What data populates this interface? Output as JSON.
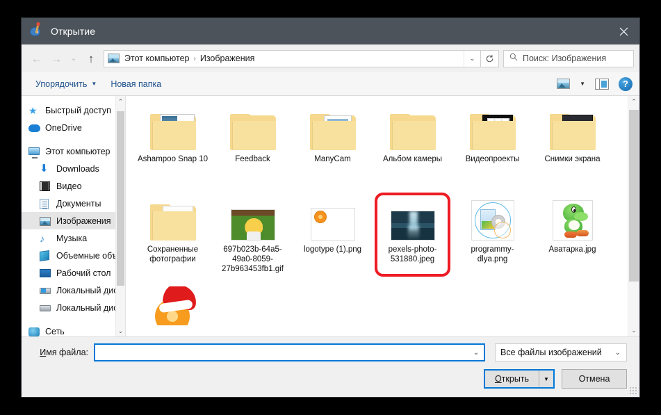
{
  "window": {
    "title": "Открытие",
    "title_icon": "paint-palette-icon",
    "close_label": "✕"
  },
  "nav": {
    "back_icon": "arrow-left-icon",
    "forward_icon": "arrow-right-icon",
    "recent_icon": "chevron-down-icon",
    "up_icon": "arrow-up-icon",
    "refresh_icon": "refresh-icon",
    "address_icon": "pictures-folder-icon",
    "breadcrumbs": [
      "Этот компьютер",
      "Изображения"
    ],
    "breadcrumb_separator": "›",
    "address_caret": "⌄"
  },
  "search": {
    "icon": "search-icon",
    "placeholder": "Поиск: Изображения"
  },
  "commandbar": {
    "organize_label": "Упорядочить",
    "organize_caret": "▼",
    "new_folder_label": "Новая папка",
    "view_icon": "view-layout-icon",
    "view_caret": "▼",
    "preview_pane_icon": "preview-pane-icon",
    "help_icon": "?"
  },
  "sidebar": {
    "items": [
      {
        "label": "Быстрый доступ",
        "icon": "star-icon",
        "indent": false,
        "selected": false
      },
      {
        "label": "OneDrive",
        "icon": "cloud-icon",
        "indent": false,
        "selected": false
      },
      {
        "label": "Этот компьютер",
        "icon": "computer-icon",
        "indent": false,
        "selected": false
      },
      {
        "label": "Downloads",
        "icon": "download-icon",
        "indent": true,
        "selected": false
      },
      {
        "label": "Видео",
        "icon": "video-icon",
        "indent": true,
        "selected": false
      },
      {
        "label": "Документы",
        "icon": "document-icon",
        "indent": true,
        "selected": false
      },
      {
        "label": "Изображения",
        "icon": "pictures-icon",
        "indent": true,
        "selected": true
      },
      {
        "label": "Музыка",
        "icon": "music-icon",
        "indent": true,
        "selected": false
      },
      {
        "label": "Объемные объ",
        "icon": "3d-objects-icon",
        "indent": true,
        "selected": false
      },
      {
        "label": "Рабочий стол",
        "icon": "desktop-icon",
        "indent": true,
        "selected": false
      },
      {
        "label": "Локальный дис",
        "icon": "windows-disk-icon",
        "indent": true,
        "selected": false
      },
      {
        "label": "Локальный дис",
        "icon": "disk-icon",
        "indent": true,
        "selected": false
      },
      {
        "label": "Сеть",
        "icon": "network-icon",
        "indent": false,
        "selected": false
      }
    ],
    "scroll_up_icon": "⌃",
    "scroll_down_icon": "⌄"
  },
  "files": {
    "items": [
      {
        "name": "Ashampoo Snap 10",
        "type": "folder",
        "thumb": "ashampoo",
        "highlighted": false
      },
      {
        "name": "Feedback",
        "type": "folder",
        "thumb": "plain",
        "highlighted": false
      },
      {
        "name": "ManyCam",
        "type": "folder",
        "thumb": "manycam",
        "highlighted": false
      },
      {
        "name": "Альбом камеры",
        "type": "folder",
        "thumb": "plain",
        "highlighted": false
      },
      {
        "name": "Видеопроекты",
        "type": "folder",
        "thumb": "vidproj",
        "highlighted": false
      },
      {
        "name": "Снимки экрана",
        "type": "folder",
        "thumb": "snimki",
        "highlighted": false
      },
      {
        "name": "Сохраненные фотографии",
        "type": "folder",
        "thumb": "savedphoto",
        "highlighted": false
      },
      {
        "name": "697b023b-64a5-49a0-8059-27b963453fb1.gif",
        "type": "image",
        "thumb": "simpsons",
        "highlighted": false
      },
      {
        "name": "logotype (1).png",
        "type": "image",
        "thumb": "logo",
        "highlighted": false
      },
      {
        "name": "pexels-photo-531880.jpeg",
        "type": "image",
        "thumb": "pexels",
        "highlighted": true
      },
      {
        "name": "programmy-dlya.png",
        "type": "image",
        "thumb": "prog",
        "highlighted": false
      },
      {
        "name": "Аватарка.jpg",
        "type": "image",
        "thumb": "yoshi",
        "highlighted": false
      },
      {
        "name": "",
        "type": "image",
        "thumb": "orangesanta",
        "highlighted": false
      }
    ],
    "scroll_up_icon": "⌃",
    "scroll_down_icon": "⌄"
  },
  "footer": {
    "filename_label_first": "И",
    "filename_label_rest": "мя файла:",
    "filename_value": "",
    "filename_caret": "⌄",
    "filetype_value": "Все файлы изображений",
    "filetype_caret": "⌄",
    "open_label_first": "О",
    "open_label_rest": "ткрыть",
    "open_caret": "▼",
    "cancel_label": "Отмена"
  },
  "colors": {
    "titlebar": "#4c535a",
    "accent": "#0078d7",
    "highlight_ring": "#ee1c25",
    "link": "#20538d"
  }
}
